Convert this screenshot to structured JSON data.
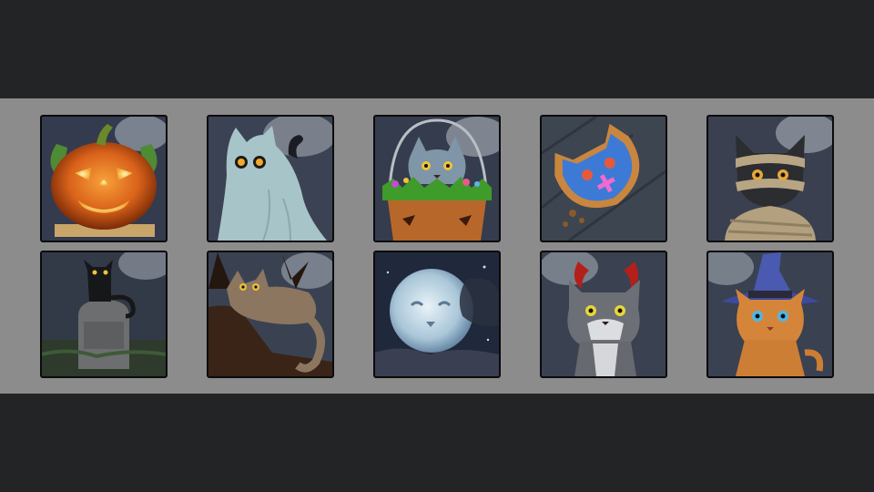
{
  "collection": {
    "tiles": [
      {
        "icon": "jack-o-lantern-cat-icon"
      },
      {
        "icon": "ghost-cat-icon"
      },
      {
        "icon": "cat-in-basket-icon"
      },
      {
        "icon": "cat-cookie-icon"
      },
      {
        "icon": "mummy-cat-icon"
      },
      {
        "icon": "cat-on-tombstone-icon"
      },
      {
        "icon": "cat-in-tree-icon"
      },
      {
        "icon": "cat-moon-icon"
      },
      {
        "icon": "devil-cat-icon"
      },
      {
        "icon": "witch-hat-cat-icon"
      }
    ]
  }
}
